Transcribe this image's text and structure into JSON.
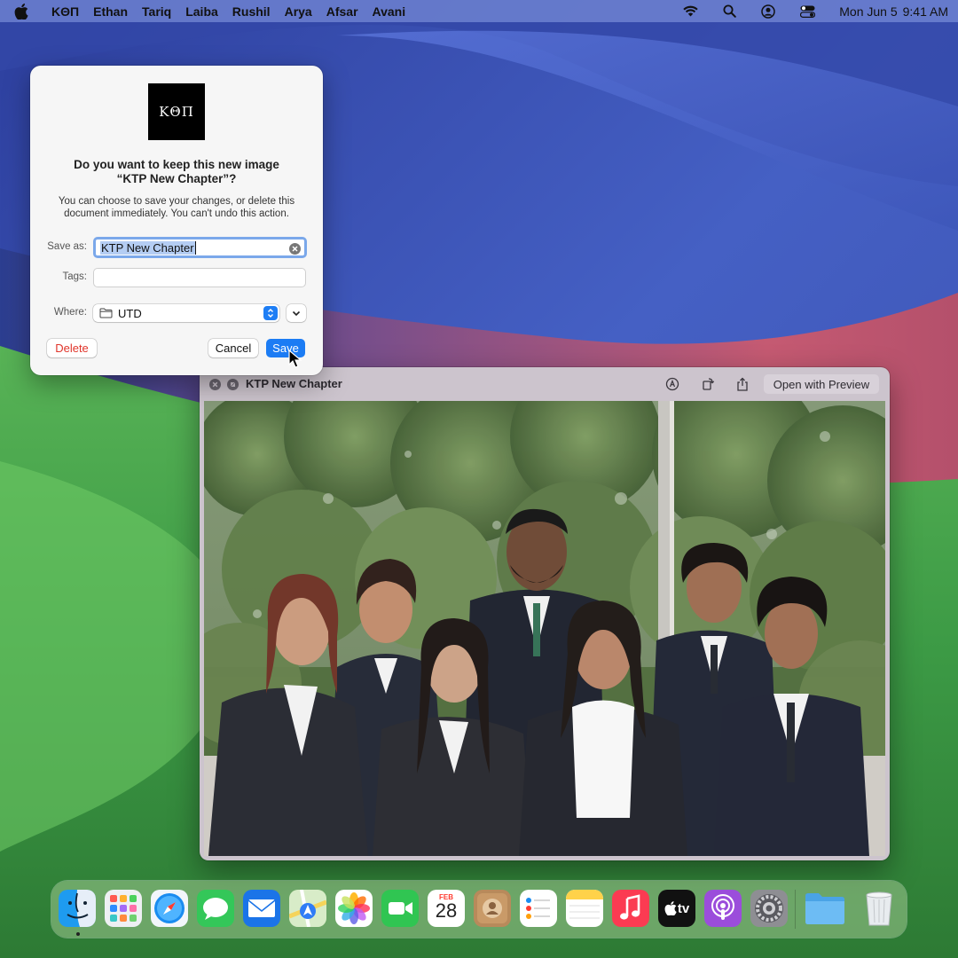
{
  "menubar": {
    "items": [
      "KΘΠ",
      "Ethan",
      "Tariq",
      "Laiba",
      "Rushil",
      "Arya",
      "Afsar",
      "Avani"
    ],
    "status_icons": [
      "wifi-icon",
      "spotlight-icon",
      "user-icon",
      "control-center-icon"
    ],
    "date": "Mon Jun 5",
    "time": "9:41 AM"
  },
  "dialog": {
    "logo_text": "KΘΠ",
    "title_line1": "Do you want to keep this new image",
    "title_line2": "“KTP New Chapter”?",
    "description": "You can choose to save your changes, or delete this document immediately. You can't undo this action.",
    "save_as_label": "Save as:",
    "save_as_value": "KTP New Chapter",
    "tags_label": "Tags:",
    "tags_value": "",
    "where_label": "Where:",
    "where_value": "UTD",
    "delete_label": "Delete",
    "cancel_label": "Cancel",
    "save_label": "Save"
  },
  "quicklook": {
    "title": "KTP New Chapter",
    "open_with_label": "Open with Preview"
  },
  "dock": {
    "calendar_month": "FEB",
    "calendar_day": "28",
    "apps": [
      "Finder",
      "Launchpad",
      "Safari",
      "Messages",
      "Mail",
      "Maps",
      "Photos",
      "FaceTime",
      "Calendar",
      "Contacts",
      "Reminders",
      "Notes",
      "Music",
      "TV",
      "Podcasts",
      "System Settings",
      "Downloads",
      "Trash"
    ],
    "tv_label": "tv"
  },
  "colors": {
    "accent": "#1c7cf4",
    "destructive": "#e0352b"
  }
}
